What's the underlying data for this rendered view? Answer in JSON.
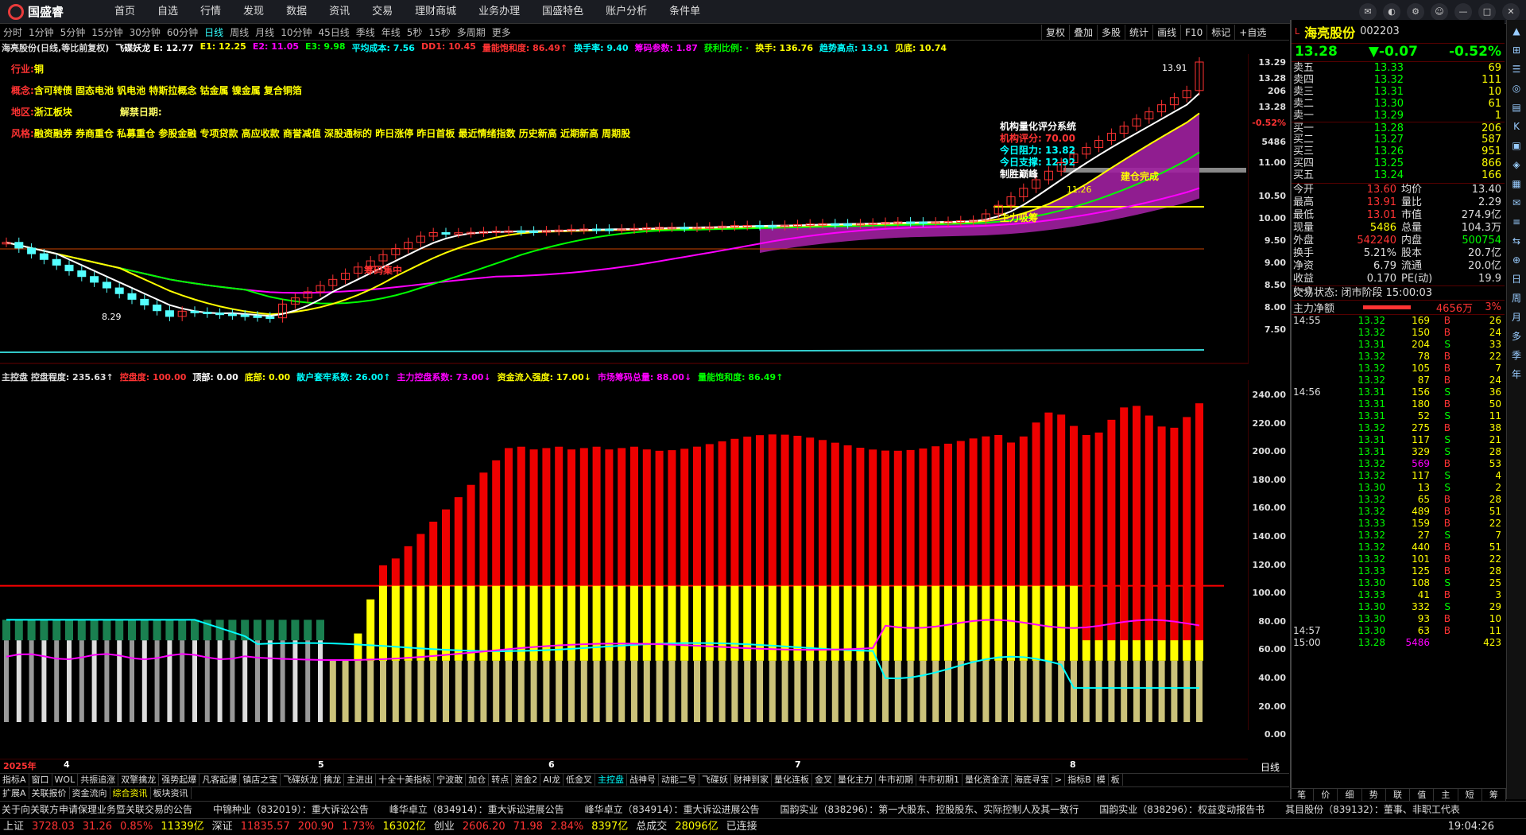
{
  "app": {
    "logo": "国盛睿",
    "menu": [
      "首页",
      "自选",
      "行情",
      "发现",
      "数据",
      "资讯",
      "交易",
      "理财商城",
      "业务办理",
      "国盛特色",
      "账户分析",
      "条件单"
    ]
  },
  "periods": [
    "分时",
    "1分钟",
    "5分钟",
    "15分钟",
    "30分钟",
    "60分钟",
    "日线",
    "周线",
    "月线",
    "10分钟",
    "45日线",
    "季线",
    "年线",
    "5秒",
    "15秒",
    "多周期",
    "更多"
  ],
  "right_tools": [
    "复权",
    "叠加",
    "多股",
    "统计",
    "画线",
    "F10",
    "标记",
    "+自选"
  ],
  "main_header": [
    {
      "t": "海亮股份(日线,等比前复权)",
      "c": "#ddd"
    },
    {
      "t": "飞碟妖龙 E: 12.77",
      "c": "#fff"
    },
    {
      "t": "E1: 12.25",
      "c": "#ff0"
    },
    {
      "t": "E2: 11.05",
      "c": "#f0f"
    },
    {
      "t": "E3: 9.98",
      "c": "#0f0"
    },
    {
      "t": "平均成本: 7.56",
      "c": "#0ff"
    },
    {
      "t": "DD1: 10.45",
      "c": "#f33"
    },
    {
      "t": "量能饱和度: 86.49↑",
      "c": "#f33"
    },
    {
      "t": "换手率: 9.40",
      "c": "#0ff"
    },
    {
      "t": "筹码参数: 1.87",
      "c": "#f0f"
    },
    {
      "t": "获利比例: ·",
      "c": "#0f0"
    },
    {
      "t": "换手: 136.76",
      "c": "#ff0"
    },
    {
      "t": "趋势高点: 13.91",
      "c": "#0ff"
    },
    {
      "t": "见底: 10.74",
      "c": "#ff0"
    }
  ],
  "info": {
    "hy_k": "行业:",
    "hy_v": "铜",
    "gn_k": "概念:",
    "gn_v": "含可转债 固态电池 钒电池 特斯拉概念 钴金属 镍金属 复合铜箔",
    "dq_k": "地区:",
    "dq_v": "浙江板块",
    "jj": "解禁日期:",
    "fg_k": "风格:",
    "fg_v": "融资融券 券商重仓 私募重仓 参股金融 专项贷款 高应收款 商誉减值 深股通标的 昨日涨停 昨日首板 最近情绪指数 历史新高 近期新高 周期股"
  },
  "overlay": {
    "title": "机构量化评分系统",
    "score": "机构评分: 70.00",
    "res": "今日阻力: 13.82",
    "sup": "今日支撑: 12.92",
    "win": "制胜巅峰",
    "jc": "建仓完成",
    "zl": "主力吸筹",
    "cm": "筹码集中",
    "hi": "13.91",
    "lo": "8.29",
    "mk": "11.26"
  },
  "price_ticks": [
    "13.29",
    "13.28",
    "206",
    "13.28",
    "-0.52%",
    "5486",
    "11.00",
    "10.50",
    "10.00",
    "9.50",
    "9.00",
    "8.50",
    "8.00",
    "7.50"
  ],
  "sub_header": [
    {
      "t": "主控盘 控盘程度: 235.63↑",
      "c": "#ddd"
    },
    {
      "t": "控盘度: 100.00",
      "c": "#f33"
    },
    {
      "t": "顶部: 0.00",
      "c": "#fff"
    },
    {
      "t": "底部: 0.00",
      "c": "#ff0"
    },
    {
      "t": "散户套牢系数: 26.00↑",
      "c": "#0ff"
    },
    {
      "t": "主力控盘系数: 73.00↓",
      "c": "#f0f"
    },
    {
      "t": "资金流入强度: 17.00↓",
      "c": "#ff0"
    },
    {
      "t": "市场筹码总量: 88.00↓",
      "c": "#f0f"
    },
    {
      "t": "量能饱和度: 86.49↑",
      "c": "#0f0"
    }
  ],
  "sub_ticks": [
    "240.00",
    "220.00",
    "200.00",
    "180.00",
    "160.00",
    "140.00",
    "120.00",
    "100.00",
    "80.00",
    "60.00",
    "40.00",
    "20.00",
    "0.00"
  ],
  "x_labels": [
    "2025年",
    "4",
    "5",
    "6",
    "7",
    "8"
  ],
  "tabs1": [
    "指标A",
    "窗口",
    "WOL",
    "共振追涨",
    "双擎擒龙",
    "强势起爆",
    "凡客起爆",
    "镇店之宝",
    "飞碟妖龙",
    "擒龙",
    "主进出",
    "十全十美指标",
    "宁波敢",
    "加仓",
    "转点",
    "资金2",
    "AI龙",
    "低金叉",
    "主控盘",
    "战神号",
    "动能二号",
    "飞碟妖",
    "财神到家",
    "量化连板",
    "金叉",
    "量化主力",
    "牛市初期",
    "牛市初期1",
    "量化资金流",
    "海底寻宝",
    ">",
    "指标B",
    "模",
    "板"
  ],
  "tabs2": [
    "扩展A",
    "关联报价",
    "资金流向",
    "综合资讯",
    "板块资讯"
  ],
  "news": [
    "关于向关联方申请保理业务暨关联交易的公告",
    "中锦种业（832019）：重大诉讼公告",
    "峰华卓立（834914）：重大诉讼进展公告",
    "峰华卓立（834914）：重大诉讼进展公告",
    "国韵实业（838296）：第一大股东、控股股东、实际控制人及其一致行",
    "国韵实业（838296）：权益变动报告书",
    "其目股份（839132）：董事、非职工代表"
  ],
  "status": {
    "sh": "上证",
    "sh_v": "3728.03",
    "sh_c": "31.26",
    "sh_p": "0.85%",
    "sh_a": "11339亿",
    "sz": "深证",
    "sz_v": "11835.57",
    "sz_c": "200.90",
    "sz_p": "1.73%",
    "sz_a": "16302亿",
    "cy": "创业",
    "cy_v": "2606.20",
    "cy_c": "71.98",
    "cy_p": "2.84%",
    "cy_a": "8397亿",
    "zcj": "总成交",
    "zcj_v": "28096亿",
    "conn": "已连接",
    "time": "19:04:26"
  },
  "stock": {
    "name": "海亮股份",
    "code": "002203",
    "price": "13.28",
    "chg": "▼-0.07",
    "pct": "-0.52%"
  },
  "orderbook": [
    [
      "卖五",
      "13.33",
      "69"
    ],
    [
      "卖四",
      "13.32",
      "111"
    ],
    [
      "卖三",
      "13.31",
      "10"
    ],
    [
      "卖二",
      "13.30",
      "61"
    ],
    [
      "卖一",
      "13.29",
      "1"
    ],
    [
      "买一",
      "13.28",
      "206"
    ],
    [
      "买二",
      "13.27",
      "587"
    ],
    [
      "买三",
      "13.26",
      "951"
    ],
    [
      "买四",
      "13.25",
      "866"
    ],
    [
      "买五",
      "13.24",
      "166"
    ]
  ],
  "stats": [
    [
      "今开",
      "13.60",
      "均价",
      "13.40"
    ],
    [
      "最高",
      "13.91",
      "量比",
      "2.29"
    ],
    [
      "最低",
      "13.01",
      "市值",
      "274.9亿"
    ],
    [
      "现量",
      "5486",
      "总量",
      "104.3万"
    ],
    [
      "外盘",
      "542240",
      "内盘",
      "500754"
    ],
    [
      "换手",
      "5.21%",
      "股本",
      "20.7亿"
    ],
    [
      "净资",
      "6.79",
      "流通",
      "20.0亿"
    ],
    [
      "收益(一)",
      "0.170",
      "PE(动)",
      "19.9"
    ]
  ],
  "trade_state": "交易状态: 闭市阶段 15:00:03",
  "zljl": {
    "label": "主力净额",
    "val": "4656万",
    "pct": "3%"
  },
  "ticks": [
    [
      "14:55",
      "13.32",
      "169",
      "B",
      "26"
    ],
    [
      "",
      "13.32",
      "150",
      "B",
      "24"
    ],
    [
      "",
      "13.31",
      "204",
      "S",
      "33"
    ],
    [
      "",
      "13.32",
      "78",
      "B",
      "22"
    ],
    [
      "",
      "13.32",
      "105",
      "B",
      "7"
    ],
    [
      "",
      "13.32",
      "87",
      "B",
      "24"
    ],
    [
      "14:56",
      "13.31",
      "156",
      "S",
      "36"
    ],
    [
      "",
      "13.31",
      "180",
      "B",
      "50"
    ],
    [
      "",
      "13.31",
      "52",
      "S",
      "11"
    ],
    [
      "",
      "13.32",
      "275",
      "B",
      "38"
    ],
    [
      "",
      "13.31",
      "117",
      "S",
      "21"
    ],
    [
      "",
      "13.31",
      "329",
      "S",
      "28"
    ],
    [
      "",
      "13.32",
      "569",
      "B",
      "53"
    ],
    [
      "",
      "13.32",
      "117",
      "S",
      "4"
    ],
    [
      "",
      "13.30",
      "13",
      "S",
      "2"
    ],
    [
      "",
      "13.32",
      "65",
      "B",
      "28"
    ],
    [
      "",
      "13.32",
      "489",
      "B",
      "51"
    ],
    [
      "",
      "13.33",
      "159",
      "B",
      "22"
    ],
    [
      "",
      "13.32",
      "27",
      "S",
      "7"
    ],
    [
      "",
      "13.32",
      "440",
      "B",
      "51"
    ],
    [
      "",
      "13.32",
      "101",
      "B",
      "22"
    ],
    [
      "",
      "13.33",
      "125",
      "B",
      "28"
    ],
    [
      "",
      "13.30",
      "108",
      "S",
      "25"
    ],
    [
      "",
      "13.33",
      "41",
      "B",
      "3"
    ],
    [
      "",
      "13.30",
      "332",
      "S",
      "29"
    ],
    [
      "",
      "13.30",
      "93",
      "B",
      "10"
    ],
    [
      "14:57",
      "13.30",
      "63",
      "B",
      "11"
    ],
    [
      "15:00",
      "13.28",
      "5486",
      "",
      "423"
    ]
  ],
  "rtabs": [
    "笔",
    "价",
    "细",
    "势",
    "联",
    "值",
    "主",
    "短",
    "筹"
  ],
  "sidebar": [
    "▲",
    "⊞",
    "☰",
    "◎",
    "▤",
    "K",
    "▣",
    "◈",
    "▦",
    "✉",
    "≡",
    "⇆",
    "⊕",
    "日",
    "周",
    "月",
    "多",
    "季",
    "年"
  ],
  "colors": {
    "up": "#ff3232",
    "down": "#54ffff",
    "ma1": "#ffffff",
    "ma2": "#ffff00",
    "ma3": "#ff00ff",
    "ma4": "#00ff00"
  }
}
